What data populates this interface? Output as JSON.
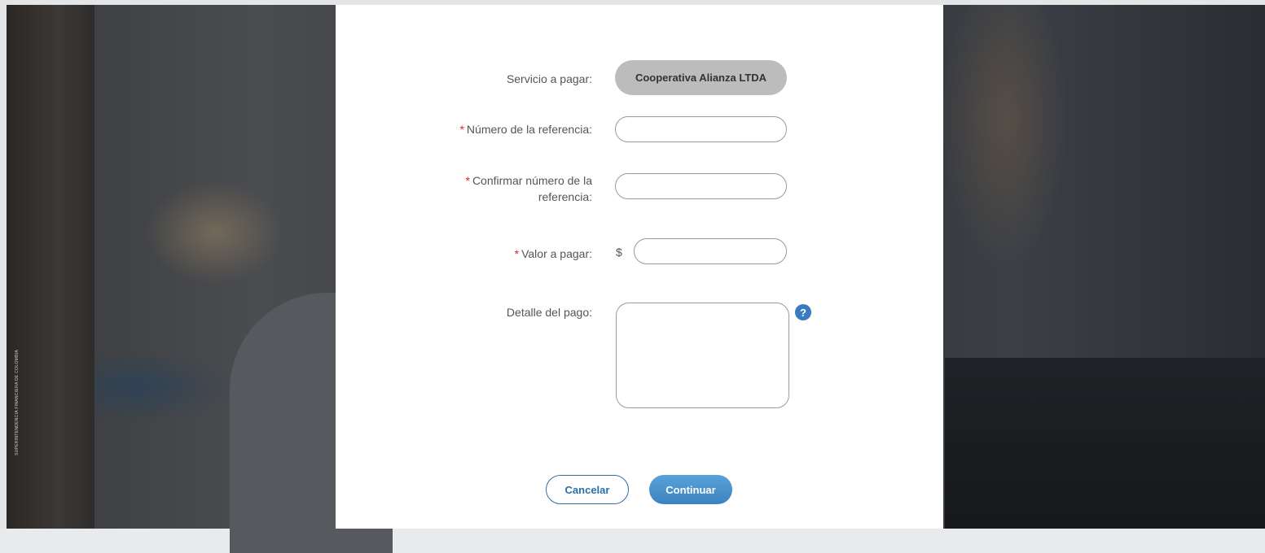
{
  "background": {
    "caption": "SUPERINTENDENCIA FINANCIERA DE COLOMBIA"
  },
  "form": {
    "service_label": "Servicio a pagar:",
    "service_value": "Cooperativa Alianza LTDA",
    "required_mark": "*",
    "reference_label": "Número de la referencia:",
    "confirm_reference_label_line1": "Confirmar número de la",
    "confirm_reference_label_line2": "referencia:",
    "amount_label": "Valor a pagar:",
    "currency_symbol": "$",
    "detail_label": "Detalle del pago:",
    "help_icon_glyph": "?"
  },
  "buttons": {
    "cancel_label": "Cancelar",
    "continue_label": "Continuar"
  },
  "colors": {
    "required": "#d9272e",
    "primary": "#3b82bf",
    "service_pill": "#bcbcbc"
  }
}
